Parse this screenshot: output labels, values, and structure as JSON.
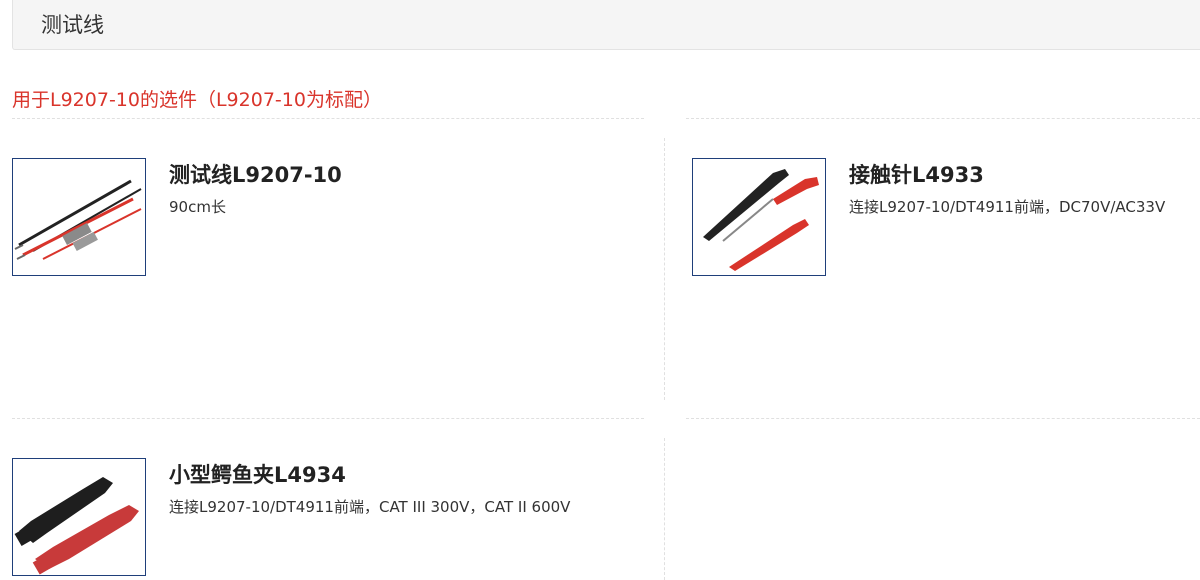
{
  "section": {
    "title": "测试线"
  },
  "subtitle": "用于L9207-10的选件（L9207-10为标配）",
  "products": [
    {
      "name": "测试线L9207-10",
      "description": "90cm长",
      "image_icon": "test-lead-icon"
    },
    {
      "name": "接触针L4933",
      "description": "连接L9207-10/DT4911前端，DC70V/AC33V",
      "image_icon": "contact-pin-icon"
    },
    {
      "name": "小型鳄鱼夹L4934",
      "description": "连接L9207-10/DT4911前端，CAT III 300V，CAT II 600V",
      "image_icon": "alligator-clip-icon"
    }
  ],
  "colors": {
    "accent_red": "#d9342b",
    "thumb_border": "#1f3f7a",
    "probe_red": "#d9342b",
    "probe_black": "#222222"
  }
}
